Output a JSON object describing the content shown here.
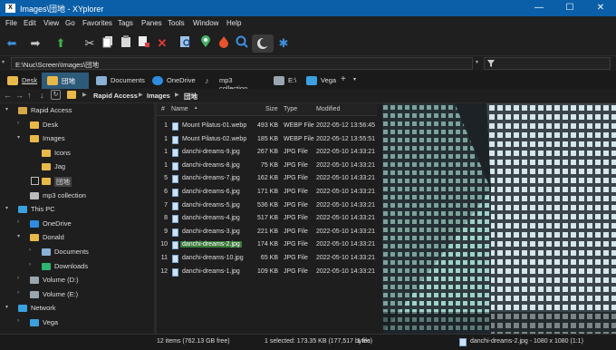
{
  "window": {
    "title": "Images\\団地 - XYplorer"
  },
  "menu": [
    "File",
    "Edit",
    "View",
    "Go",
    "Favorites",
    "Tags",
    "Panes",
    "Tools",
    "Window",
    "Help"
  ],
  "toolbar": [
    "back-icon",
    "forward-icon",
    "up-icon",
    "cut-icon",
    "copy-icon",
    "paste-icon",
    "copy-to-icon",
    "delete-icon",
    "find-icon",
    "location-icon",
    "hot-icon",
    "search-icon",
    "dark-mode-icon",
    "settings-icon"
  ],
  "address": {
    "path": "E:\\Nuc\\Screen\\Images\\団地"
  },
  "tabs": [
    {
      "label": "Desk",
      "icon": "folder-icon",
      "active": false
    },
    {
      "label": "団地",
      "icon": "folder-icon",
      "active": true
    },
    {
      "label": "Documents",
      "icon": "documents-icon",
      "active": false
    },
    {
      "label": "OneDrive",
      "icon": "onedrive-icon",
      "active": false
    },
    {
      "label": "mp3 collection",
      "icon": "music-icon",
      "active": false
    },
    {
      "label": "E:\\",
      "icon": "drive-icon",
      "active": false
    },
    {
      "label": "Vega",
      "icon": "computer-icon",
      "active": false
    }
  ],
  "breadcrumb": [
    "Rapid Access",
    "Images",
    "団地"
  ],
  "tree": [
    {
      "label": "Rapid Access",
      "level": 0,
      "arrow": "▾",
      "color": "#d7a84a"
    },
    {
      "label": "Desk",
      "level": 1,
      "arrow": "›",
      "color": "#e8b84a"
    },
    {
      "label": "Images",
      "level": 1,
      "arrow": "▾",
      "color": "#e8b84a"
    },
    {
      "label": "Icons",
      "level": 2,
      "arrow": "",
      "color": "#e8b84a"
    },
    {
      "label": "Jag",
      "level": 2,
      "arrow": "",
      "color": "#e8b84a"
    },
    {
      "label": "団地",
      "level": 2,
      "arrow": "",
      "color": "#e8b84a",
      "selected": true
    },
    {
      "label": "mp3 collection",
      "level": 1,
      "arrow": "",
      "color": "#bbbbbb"
    },
    {
      "label": "This PC",
      "level": 0,
      "arrow": "▾",
      "color": "#3aa0e0"
    },
    {
      "label": "OneDrive",
      "level": 1,
      "arrow": "›",
      "color": "#2d8be0"
    },
    {
      "label": "Donald",
      "level": 1,
      "arrow": "▾",
      "color": "#e8b84a"
    },
    {
      "label": "Documents",
      "level": 2,
      "arrow": "›",
      "color": "#8ab0d6"
    },
    {
      "label": "Downloads",
      "level": 2,
      "arrow": "›",
      "color": "#2fb370"
    },
    {
      "label": "Volume (D:)",
      "level": 1,
      "arrow": "›",
      "color": "#9aa5b0"
    },
    {
      "label": "Volume (E:)",
      "level": 1,
      "arrow": "›",
      "color": "#9aa5b0"
    },
    {
      "label": "Network",
      "level": 0,
      "arrow": "▾",
      "color": "#3aa0e0"
    },
    {
      "label": "Vega",
      "level": 1,
      "arrow": "›",
      "color": "#3aa0e0"
    }
  ],
  "columns": {
    "num": "#",
    "name": "Name",
    "size": "Size",
    "type": "Type",
    "modified": "Modified"
  },
  "files": [
    {
      "num": "1",
      "name": "Mount Pilatus-01.webp",
      "size": "493 KB",
      "type": "WEBP File",
      "modified": "2022-05-12 13:56:45"
    },
    {
      "num": "1",
      "name": "Mount Pilatus-02.webp",
      "size": "185 KB",
      "type": "WEBP File",
      "modified": "2022-05-12 13:55:51"
    },
    {
      "num": "1",
      "name": "danchi-dreams-9.jpg",
      "size": "267 KB",
      "type": "JPG File",
      "modified": "2022-05-10 14:33:21"
    },
    {
      "num": "1",
      "name": "danchi-dreams-8.jpg",
      "size": "75 KB",
      "type": "JPG File",
      "modified": "2022-05-10 14:33:21"
    },
    {
      "num": "5",
      "name": "danchi-dreams-7.jpg",
      "size": "162 KB",
      "type": "JPG File",
      "modified": "2022-05-10 14:33:21"
    },
    {
      "num": "6",
      "name": "danchi-dreams-6.jpg",
      "size": "171 KB",
      "type": "JPG File",
      "modified": "2022-05-10 14:33:21"
    },
    {
      "num": "7",
      "name": "danchi-dreams-5.jpg",
      "size": "536 KB",
      "type": "JPG File",
      "modified": "2022-05-10 14:33:21"
    },
    {
      "num": "8",
      "name": "danchi-dreams-4.jpg",
      "size": "517 KB",
      "type": "JPG File",
      "modified": "2022-05-10 14:33:21"
    },
    {
      "num": "9",
      "name": "danchi-dreams-3.jpg",
      "size": "221 KB",
      "type": "JPG File",
      "modified": "2022-05-10 14:33:21"
    },
    {
      "num": "10",
      "name": "danchi-dreams-2.jpg",
      "size": "174 KB",
      "type": "JPG File",
      "modified": "2022-05-10 14:33:21",
      "selected": true
    },
    {
      "num": "11",
      "name": "danchi-dreams-10.jpg",
      "size": "65 KB",
      "type": "JPG File",
      "modified": "2022-05-10 14:33:21"
    },
    {
      "num": "12",
      "name": "danchi-dreams-1.jpg",
      "size": "109 KB",
      "type": "JPG File",
      "modified": "2022-05-10 14:33:21"
    }
  ],
  "status": {
    "items": "12 items (762.13 GB free)",
    "selected": "1 selected: 173.35 KB (177,517 bytes)",
    "files": "1 file",
    "preview_info": "danchi-dreams-2.jpg - 1080 x 1080 (1:1)"
  }
}
